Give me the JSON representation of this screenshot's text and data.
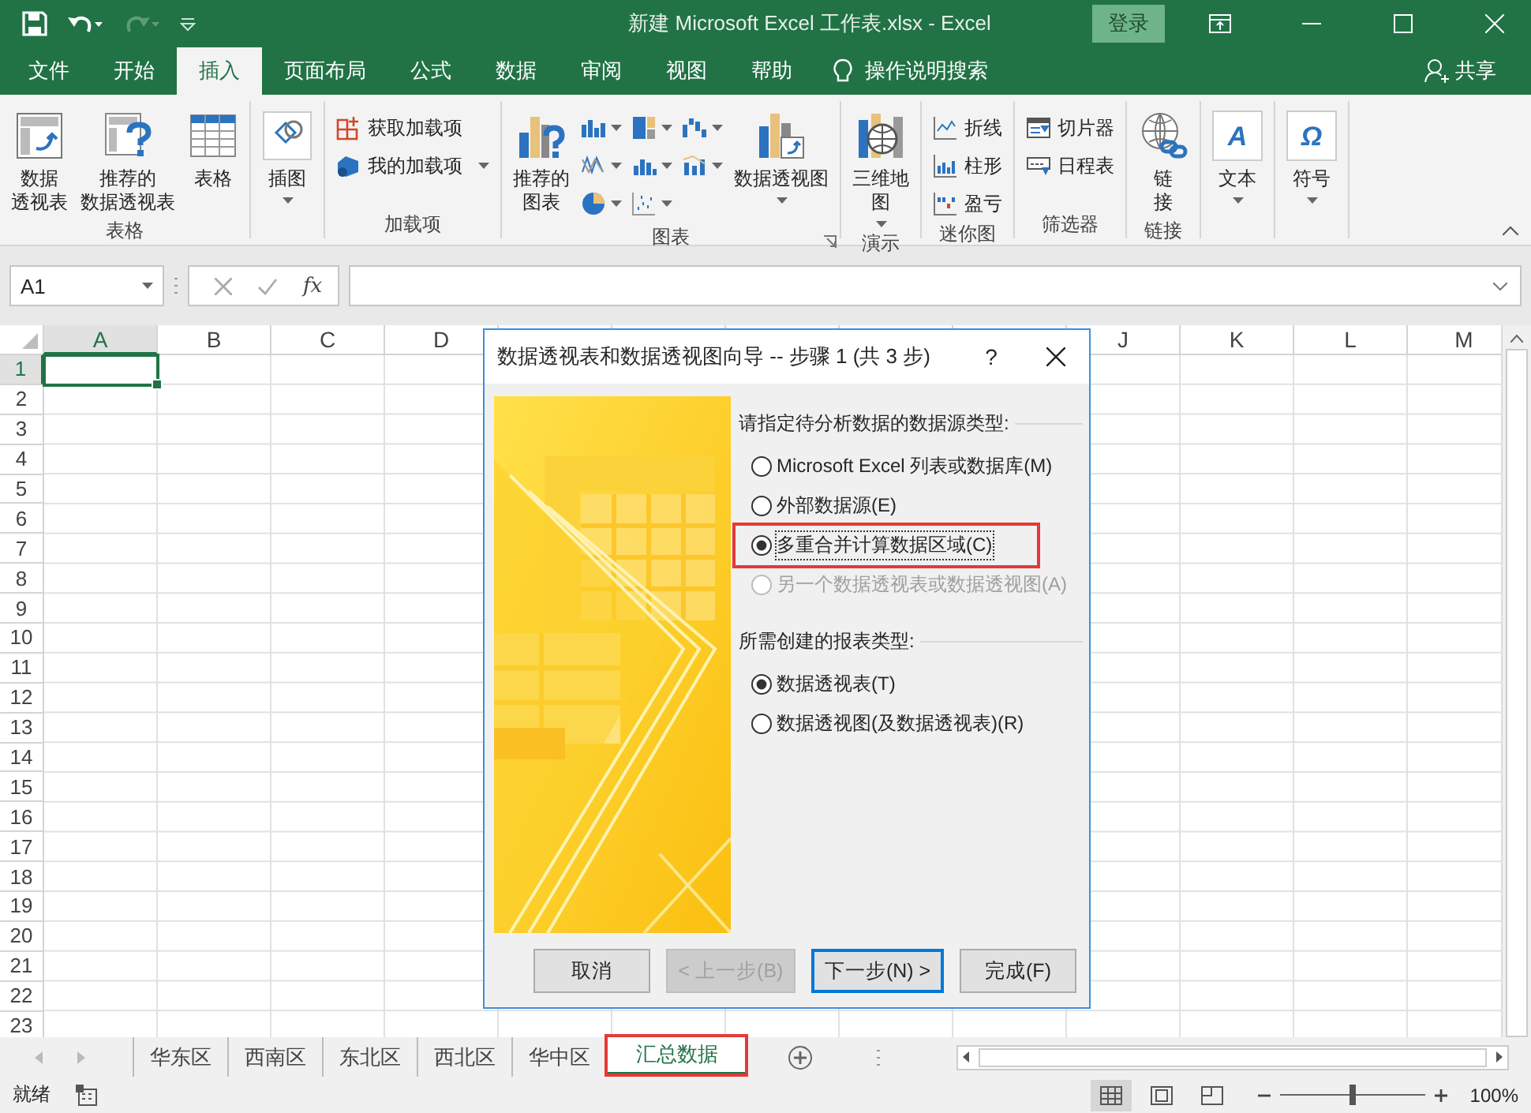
{
  "window": {
    "title": "新建 Microsoft Excel 工作表.xlsx  -  Excel",
    "sign_in": "登录"
  },
  "ribbon_tabs": [
    {
      "label": "文件",
      "selected": false
    },
    {
      "label": "开始",
      "selected": false
    },
    {
      "label": "插入",
      "selected": true
    },
    {
      "label": "页面布局",
      "selected": false
    },
    {
      "label": "公式",
      "selected": false
    },
    {
      "label": "数据",
      "selected": false
    },
    {
      "label": "审阅",
      "selected": false
    },
    {
      "label": "视图",
      "selected": false
    },
    {
      "label": "帮助",
      "selected": false
    }
  ],
  "tell_me": "操作说明搜索",
  "share": "共享",
  "ribbon": {
    "groups": [
      {
        "label": "表格",
        "items": [
          {
            "kind": "large",
            "lines": [
              "数据",
              "透视表"
            ],
            "dropdown": false
          },
          {
            "kind": "large",
            "lines": [
              "推荐的",
              "数据透视表"
            ],
            "dropdown": false
          },
          {
            "kind": "large",
            "lines": [
              "表格"
            ],
            "dropdown": false
          }
        ]
      },
      {
        "items": [
          {
            "kind": "large",
            "lines": [
              "插图"
            ],
            "dropdown": true
          }
        ]
      },
      {
        "label": "加载项",
        "items": [
          {
            "kind": "stack",
            "entries": [
              {
                "label": "获取加载项",
                "dropdown": false
              },
              {
                "label": "我的加载项",
                "dropdown": true
              }
            ]
          }
        ]
      },
      {
        "label": "图表",
        "launcher": true,
        "items": [
          {
            "kind": "large",
            "lines": [
              "推荐的",
              "图表"
            ],
            "dropdown": false
          },
          {
            "kind": "gallery"
          },
          {
            "kind": "large",
            "lines": [
              "数据透视图"
            ],
            "dropdown": true
          }
        ]
      },
      {
        "label": "演示",
        "items": [
          {
            "kind": "large",
            "lines": [
              "三维地",
              "图"
            ],
            "dropdown": true
          }
        ]
      },
      {
        "label": "迷你图",
        "items": [
          {
            "kind": "stack",
            "entries": [
              {
                "label": "折线",
                "dropdown": false
              },
              {
                "label": "柱形",
                "dropdown": false
              },
              {
                "label": "盈亏",
                "dropdown": false
              }
            ]
          }
        ]
      },
      {
        "label": "筛选器",
        "items": [
          {
            "kind": "stack",
            "entries": [
              {
                "label": "切片器",
                "dropdown": false
              },
              {
                "label": "日程表",
                "dropdown": false
              }
            ]
          }
        ]
      },
      {
        "label": "链接",
        "items": [
          {
            "kind": "large",
            "lines": [
              "链",
              "接"
            ],
            "dropdown": false
          }
        ]
      },
      {
        "items": [
          {
            "kind": "glyph",
            "glyph": "A",
            "lines": [
              "文本"
            ],
            "dropdown": true
          }
        ]
      },
      {
        "items": [
          {
            "kind": "glyph",
            "glyph": "Ω",
            "lines": [
              "符号"
            ],
            "dropdown": true
          }
        ]
      }
    ]
  },
  "formula_bar": {
    "name_box": "A1",
    "function_button": "fx"
  },
  "columns": [
    {
      "label": "A",
      "selected": true
    },
    {
      "label": "B",
      "selected": false
    },
    {
      "label": "C",
      "selected": false
    },
    {
      "label": "D",
      "selected": false
    },
    {
      "selected": false
    },
    {
      "selected": false
    },
    {
      "selected": false
    },
    {
      "selected": false
    },
    {
      "selected": false
    },
    {
      "label": "J",
      "selected": false
    },
    {
      "label": "K",
      "selected": false
    },
    {
      "label": "L",
      "selected": false
    },
    {
      "label": "M",
      "selected": false
    }
  ],
  "rows": [
    {
      "label": "1",
      "selected": true
    },
    {
      "label": "2",
      "selected": false
    },
    {
      "label": "3",
      "selected": false
    },
    {
      "label": "4",
      "selected": false
    },
    {
      "label": "5",
      "selected": false
    },
    {
      "label": "6",
      "selected": false
    },
    {
      "label": "7",
      "selected": false
    },
    {
      "label": "8",
      "selected": false
    },
    {
      "label": "9",
      "selected": false
    },
    {
      "label": "10",
      "selected": false
    },
    {
      "label": "11",
      "selected": false
    },
    {
      "label": "12",
      "selected": false
    },
    {
      "label": "13",
      "selected": false
    },
    {
      "label": "14",
      "selected": false
    },
    {
      "label": "15",
      "selected": false
    },
    {
      "label": "16",
      "selected": false
    },
    {
      "label": "17",
      "selected": false
    },
    {
      "label": "18",
      "selected": false
    },
    {
      "label": "19",
      "selected": false
    },
    {
      "label": "20",
      "selected": false
    },
    {
      "label": "21",
      "selected": false
    },
    {
      "label": "22",
      "selected": false
    },
    {
      "label": "23",
      "selected": false
    }
  ],
  "sheet_tabs": [
    {
      "label": "华东区",
      "selected": false,
      "highlighted": false
    },
    {
      "label": "西南区",
      "selected": false,
      "highlighted": false
    },
    {
      "label": "东北区",
      "selected": false,
      "highlighted": false
    },
    {
      "label": "西北区",
      "selected": false,
      "highlighted": false
    },
    {
      "label": "华中区",
      "selected": false,
      "highlighted": false
    },
    {
      "label": "汇总数据",
      "selected": true,
      "highlighted": true
    }
  ],
  "status_bar": {
    "status": "就绪",
    "views": [
      {
        "selected": true
      },
      {
        "selected": false
      },
      {
        "selected": false
      }
    ],
    "zoom": {
      "level": 0.5,
      "reading": "100%"
    }
  },
  "dialog": {
    "title": "数据透视表和数据透视图向导 -- 步骤 1 (共 3 步)",
    "help": "?",
    "sections": [
      {
        "label": "请指定待分析数据的数据源类型:",
        "options": [
          {
            "label": "Microsoft Excel 列表或数据库(M)",
            "selected": false,
            "disabled": false,
            "highlighted": false,
            "focused": false
          },
          {
            "label": "外部数据源(E)",
            "selected": false,
            "disabled": false,
            "highlighted": false,
            "focused": false
          },
          {
            "label": "多重合并计算数据区域(C)",
            "selected": true,
            "disabled": false,
            "highlighted": true,
            "focused": true
          },
          {
            "label": "另一个数据透视表或数据透视图(A)",
            "selected": false,
            "disabled": true,
            "highlighted": false,
            "focused": false
          }
        ]
      },
      {
        "label": "所需创建的报表类型:",
        "options": [
          {
            "label": "数据透视表(T)",
            "selected": true,
            "disabled": false,
            "highlighted": false,
            "focused": false
          },
          {
            "label": "数据透视图(及数据透视表)(R)",
            "selected": false,
            "disabled": false,
            "highlighted": false,
            "focused": false
          }
        ]
      }
    ],
    "buttons": [
      {
        "label": "取消",
        "disabled": false,
        "default": false
      },
      {
        "label": "< 上一步(B)",
        "disabled": true,
        "default": false
      },
      {
        "label": "下一步(N) >",
        "disabled": false,
        "default": true
      },
      {
        "label": "完成(F)",
        "disabled": false,
        "default": false
      }
    ]
  }
}
